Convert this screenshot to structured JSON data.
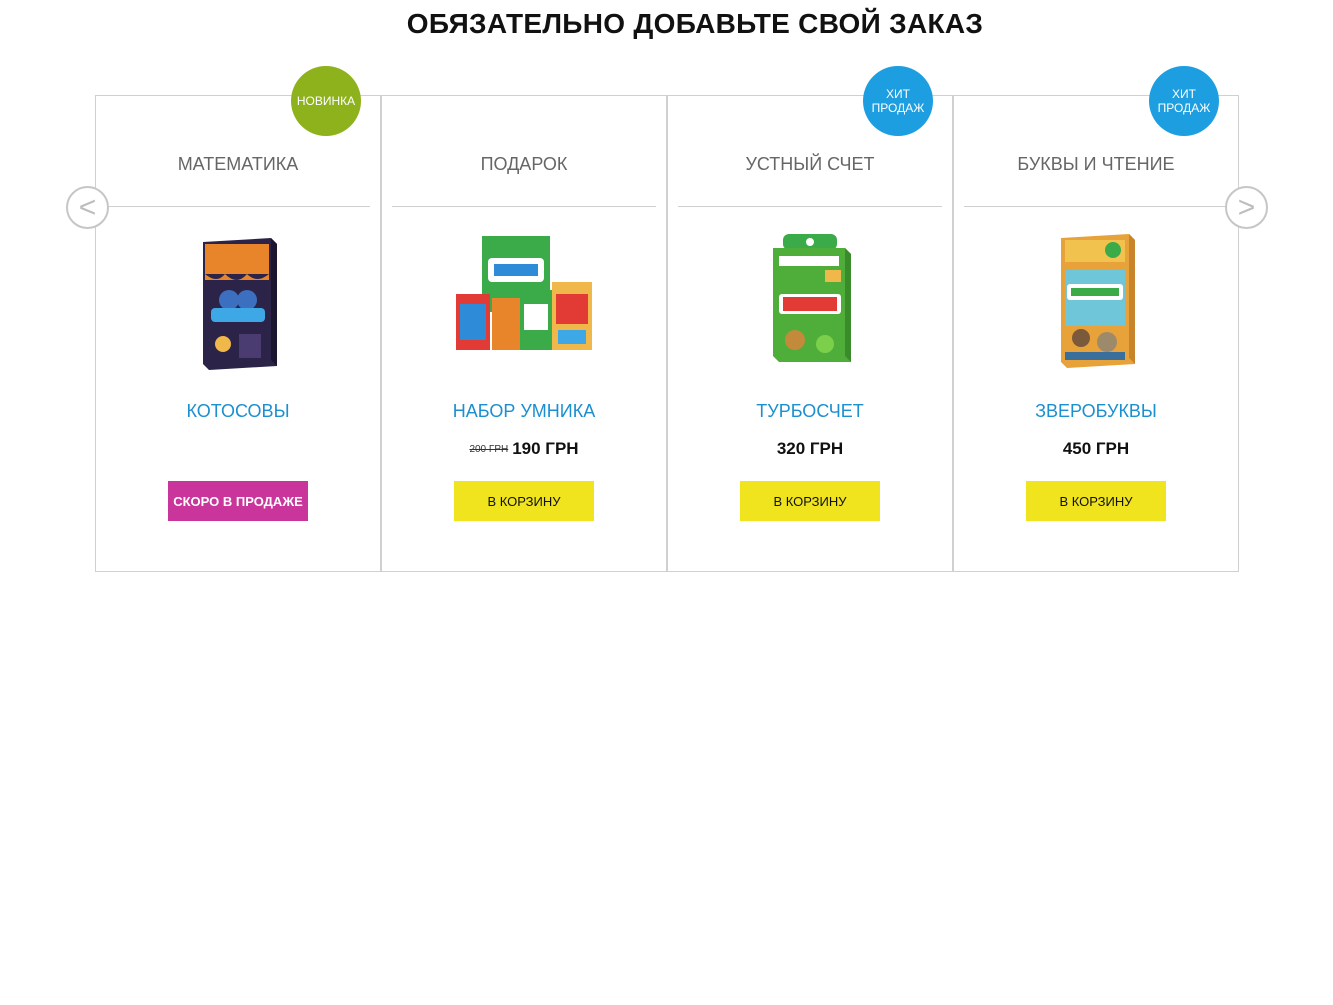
{
  "title": "ОБЯЗАТЕЛЬНО ДОБАВЬТЕ СВОЙ ЗАКАЗ",
  "navigation": {
    "prev": "<",
    "next": ">"
  },
  "products": [
    {
      "badge": "НОВИНКА",
      "category": "МАТЕМАТИКА",
      "name": "КОТОСОВЫ",
      "old_price": "",
      "price": "",
      "button": "СКОРО В ПРОДАЖЕ"
    },
    {
      "badge": "",
      "category": "ПОДАРОК",
      "name": "НАБОР УМНИКА",
      "old_price": "200 ГРН",
      "price": "190 ГРН",
      "button": "В КОРЗИНУ"
    },
    {
      "badge": "ХИТ ПРОДАЖ",
      "category": "УСТНЫЙ СЧЕТ",
      "name": "ТУРБОСЧЕТ",
      "old_price": "",
      "price": "320 ГРН",
      "button": "В КОРЗИНУ"
    },
    {
      "badge": "ХИТ ПРОДАЖ",
      "category": "БУКВЫ И ЧТЕНИЕ",
      "name": "ЗВЕРОБУКВЫ",
      "old_price": "",
      "price": "450 ГРН",
      "button": "В КОРЗИНУ"
    }
  ],
  "colors": {
    "badge_new": "#8db21c",
    "badge_hit": "#1d9ee0",
    "product_name": "#1b8fd0",
    "cart_button": "#efe41e",
    "soon_button": "#c9359b"
  }
}
